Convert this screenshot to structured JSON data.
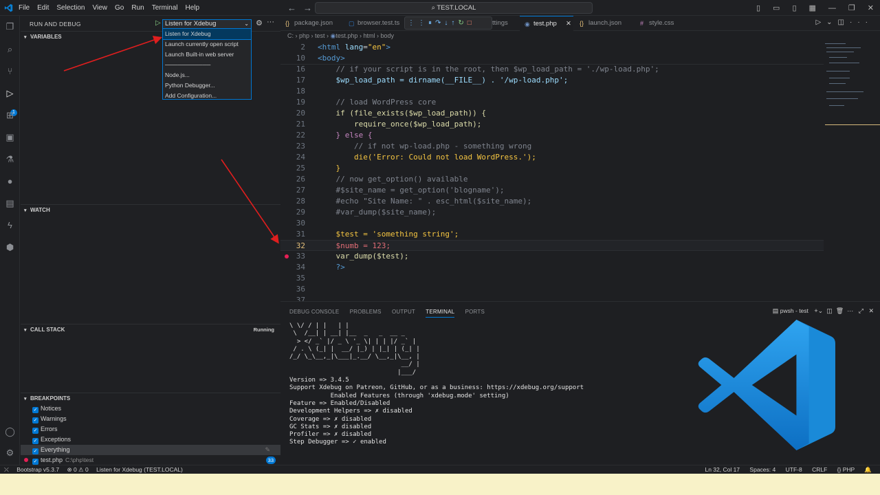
{
  "menu": [
    "File",
    "Edit",
    "Selection",
    "View",
    "Go",
    "Run",
    "Terminal",
    "Help"
  ],
  "search": {
    "text": "TEST.LOCAL"
  },
  "sidebar": {
    "title": "RUN AND DEBUG",
    "config_selected": "Listen for Xdebug",
    "sections": {
      "variables": "VARIABLES",
      "watch": "WATCH",
      "call_stack": "CALL STACK",
      "call_stack_status": "Running",
      "breakpoints": "BREAKPOINTS"
    },
    "breakpoints": [
      {
        "label": "Notices"
      },
      {
        "label": "Warnings"
      },
      {
        "label": "Errors"
      },
      {
        "label": "Exceptions"
      },
      {
        "label": "Everything"
      }
    ],
    "bp_file": {
      "name": "test.php",
      "path": "C:\\php\\test",
      "count": "33"
    }
  },
  "dropdown": {
    "items": [
      "Listen for Xdebug",
      "Launch currently open script",
      "Launch Built-in web server",
      "Node.js...",
      "Python Debugger...",
      "Add Configuration..."
    ],
    "separator": "───────────"
  },
  "tabs": [
    {
      "label": "package.json",
      "icon": "{}"
    },
    {
      "label": "browser.test.ts",
      "icon": "ts"
    },
    {
      "label": "settings",
      "icon": ""
    },
    {
      "label": "test.php",
      "icon": "php",
      "active": true
    },
    {
      "label": "launch.json",
      "icon": "{}"
    },
    {
      "label": "style.css",
      "icon": "#"
    }
  ],
  "breadcrumb": [
    "C:",
    "php",
    "test",
    "test.php",
    "html",
    "body"
  ],
  "editor": {
    "sticky": [
      {
        "n": "2",
        "html": "html"
      },
      {
        "n": "10",
        "html": "body"
      }
    ],
    "lines": [
      {
        "n": "16",
        "text": "    // if your script is in the root, then $wp_load_path = './wp-load.php';"
      },
      {
        "n": "17",
        "text": "    $wp_load_path = dirname(__FILE__) . '/wp-load.php';"
      },
      {
        "n": "18",
        "text": ""
      },
      {
        "n": "19",
        "text": "    // load WordPress core"
      },
      {
        "n": "20",
        "text": "    if (file_exists($wp_load_path)) {"
      },
      {
        "n": "21",
        "text": "        require_once($wp_load_path);"
      },
      {
        "n": "22",
        "text": "    } else {"
      },
      {
        "n": "23",
        "text": "        // if not wp-load.php - something wrong"
      },
      {
        "n": "24",
        "text": "        die('Error: Could not load WordPress.');"
      },
      {
        "n": "25",
        "text": "    }"
      },
      {
        "n": "26",
        "text": "    // now get_option() available"
      },
      {
        "n": "27",
        "text": "    #$site_name = get_option('blogname');"
      },
      {
        "n": "28",
        "text": "    #echo \"Site Name: \" . esc_html($site_name);"
      },
      {
        "n": "29",
        "text": "    #var_dump($site_name);"
      },
      {
        "n": "30",
        "text": ""
      },
      {
        "n": "31",
        "text": "    $test = 'something string';"
      },
      {
        "n": "32",
        "text": "    $numb = 123;"
      },
      {
        "n": "33",
        "text": "    var_dump($test);"
      },
      {
        "n": "34",
        "text": "    ?>"
      },
      {
        "n": "35",
        "text": ""
      },
      {
        "n": "36",
        "text": ""
      },
      {
        "n": "37",
        "text": ""
      }
    ]
  },
  "panel": {
    "tabs": [
      "DEBUG CONSOLE",
      "PROBLEMS",
      "OUTPUT",
      "TERMINAL",
      "PORTS"
    ],
    "active_tab": "TERMINAL",
    "shell": "pwsh - test",
    "terminal_lines": [
      "\\ \\/ / | |   | |",
      " \\  /__| | __| |__  _   _  __ _",
      "  > </ _` |/ _ \\ '_ \\| | | |/ _` |",
      " / . \\ (_| |  __/ |_) | |_| | (_| |",
      "/_/ \\_\\__,_|\\___|_.__/ \\__,_|\\__, |",
      "                              __/ |",
      "                             |___/",
      "",
      "Version => 3.4.5",
      "Support Xdebug on Patreon, GitHub, or as a business: https://xdebug.org/support",
      "",
      "           Enabled Features (through 'xdebug.mode' setting)",
      "Feature => Enabled/Disabled",
      "Development Helpers => ✗ disabled",
      "Coverage => ✗ disabled",
      "GC Stats => ✗ disabled",
      "Profiler => ✗ disabled",
      "Step Debugger => ✓ enabled"
    ]
  },
  "status": {
    "left": [
      "Bootstrap v5.3.7",
      "⊗ 0 ⚠ 0",
      "Listen for Xdebug (TEST.LOCAL)"
    ],
    "right": [
      "Ln 32, Col 17",
      "Spaces: 4",
      "UTF-8",
      "CRLF",
      "{} PHP"
    ]
  },
  "colors": {
    "accent": "#0078d4",
    "breakpoint": "#e51f55",
    "arrow": "#e01e1e"
  }
}
